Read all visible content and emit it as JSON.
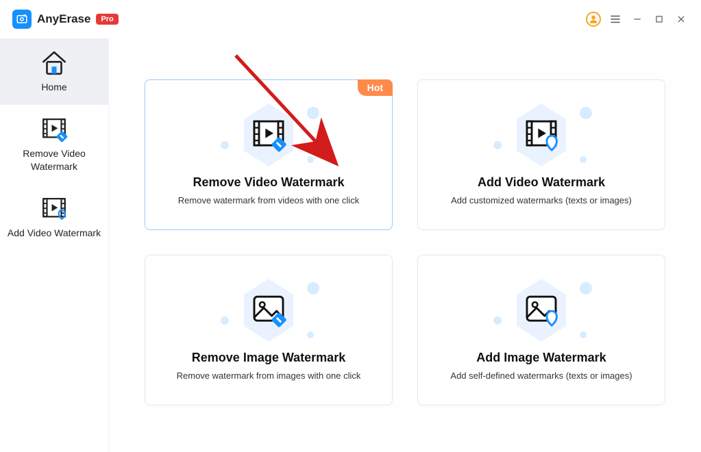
{
  "app": {
    "name": "AnyErase",
    "badge": "Pro"
  },
  "sidebar": {
    "items": [
      {
        "label": "Home"
      },
      {
        "label": "Remove Video Watermark"
      },
      {
        "label": "Add Video Watermark"
      }
    ]
  },
  "cards": [
    {
      "title": "Remove Video Watermark",
      "desc": "Remove watermark from videos with one click",
      "hot": "Hot"
    },
    {
      "title": "Add Video Watermark",
      "desc": "Add customized watermarks (texts or images)"
    },
    {
      "title": "Remove Image Watermark",
      "desc": "Remove watermark from images with one click"
    },
    {
      "title": "Add Image Watermark",
      "desc": "Add self-defined watermarks  (texts or images)"
    }
  ]
}
